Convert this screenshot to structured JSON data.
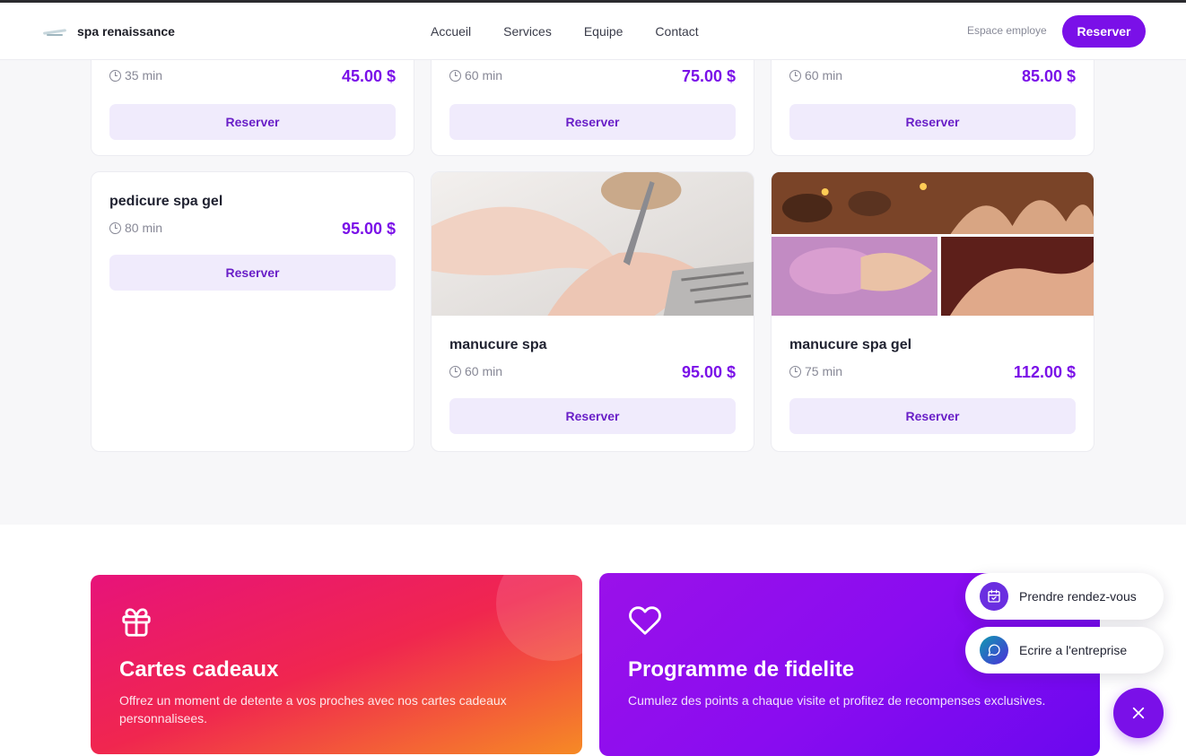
{
  "header": {
    "brand_name": "spa renaissance",
    "nav": [
      "Accueil",
      "Services",
      "Equipe",
      "Contact"
    ],
    "employee_link": "Espace employe",
    "reserve_button": "Reserver"
  },
  "services": [
    {
      "title": "",
      "duration": "35 min",
      "price": "45.00 $",
      "button": "Reserver"
    },
    {
      "title": "",
      "duration": "60 min",
      "price": "75.00 $",
      "button": "Reserver"
    },
    {
      "title": "",
      "duration": "60 min",
      "price": "85.00 $",
      "button": "Reserver"
    },
    {
      "title": "pedicure spa gel",
      "duration": "80 min",
      "price": "95.00 $",
      "button": "Reserver"
    },
    {
      "title": "manucure spa",
      "duration": "60 min",
      "price": "95.00 $",
      "button": "Reserver"
    },
    {
      "title": "manucure spa gel",
      "duration": "75 min",
      "price": "112.00 $",
      "button": "Reserver"
    }
  ],
  "promos": {
    "gift": {
      "title": "Cartes cadeaux",
      "description": "Offrez un moment de detente a vos proches avec nos cartes cadeaux personnalisees."
    },
    "loyalty": {
      "title": "Programme de fidelite",
      "description": "Cumulez des points a chaque visite et profitez de recompenses exclusives."
    }
  },
  "floating": {
    "appointment": "Prendre rendez-vous",
    "message": "Ecrire a l'entreprise"
  },
  "colors": {
    "accent": "#7a10e8",
    "price": "#7a10e8",
    "button_bg": "#f0ebfc",
    "gift_gradient": [
      "#e7137a",
      "#f68a25"
    ],
    "loyalty_gradient": [
      "#9a11e9",
      "#6b08ef"
    ]
  },
  "icons": {
    "logo": "spa-logo",
    "duration": "clock-icon",
    "gift": "gift-icon",
    "loyalty": "heart-icon",
    "appointment": "calendar-check-icon",
    "message": "chat-bubble-icon",
    "close": "close-icon"
  }
}
